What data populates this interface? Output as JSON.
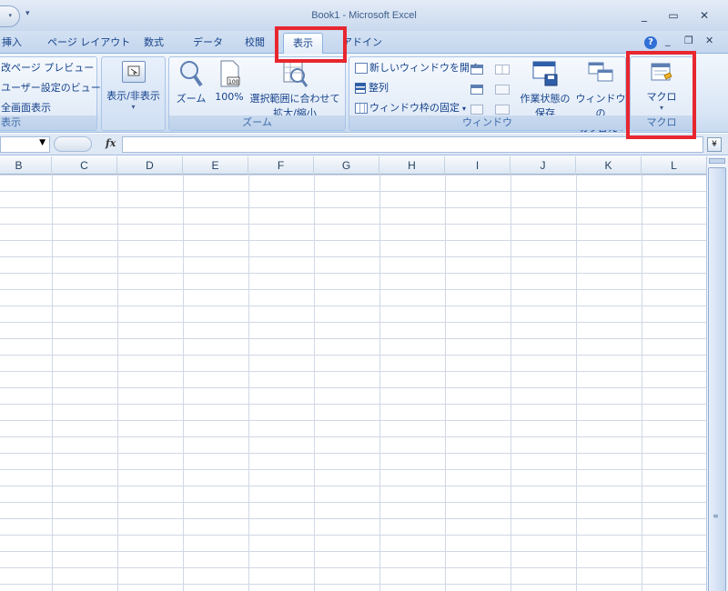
{
  "window": {
    "title": "Book1 - Microsoft Excel",
    "min_glyph": "_",
    "max_glyph": "▭",
    "close_glyph": "✕"
  },
  "tabs": [
    {
      "label": "挿入"
    },
    {
      "label": "ページ レイアウト"
    },
    {
      "label": "数式"
    },
    {
      "label": "データ"
    },
    {
      "label": "校閲"
    },
    {
      "label": "表示",
      "active": true
    },
    {
      "label": "アドイン"
    }
  ],
  "ribbon": {
    "views": {
      "label": "表示",
      "items": [
        "改ページ プレビュー",
        "ユーザー設定のビュー",
        "全画面表示"
      ]
    },
    "showhide": {
      "button": "表示/非表示"
    },
    "zoom": {
      "label": "ズーム",
      "zoom_button": "ズーム",
      "hundred_button": "100%",
      "selection_line1": "選択範囲に合わせて",
      "selection_line2": "拡大/縮小"
    },
    "window": {
      "label": "ウィンドウ",
      "new_window": "新しいウィンドウを開く",
      "arrange": "整列",
      "freeze": "ウィンドウ枠の固定",
      "save_ws_line1": "作業状態の",
      "save_ws_line2": "保存",
      "switch_line1": "ウィンドウの",
      "switch_line2": "切り替え"
    },
    "macro": {
      "label": "マクロ",
      "button": "マクロ"
    }
  },
  "formula_bar": {
    "fx": "fx"
  },
  "columns": [
    "B",
    "C",
    "D",
    "E",
    "F",
    "G",
    "H",
    "I",
    "J",
    "K",
    "L"
  ],
  "colors": {
    "highlight": "#e8262f",
    "ribbon_text": "#15428b"
  }
}
